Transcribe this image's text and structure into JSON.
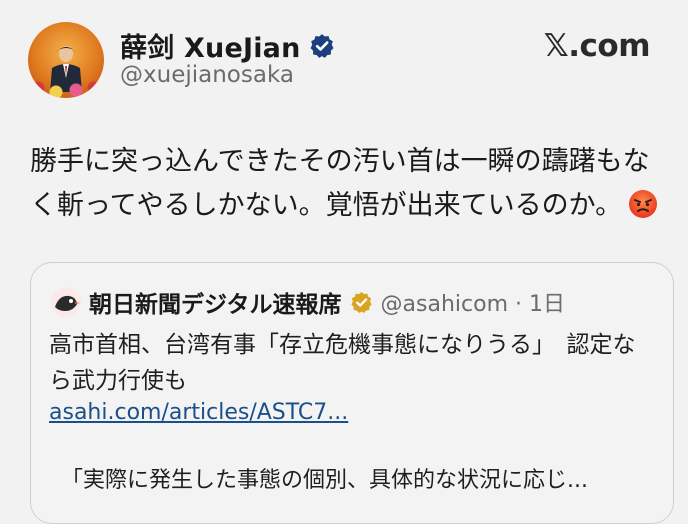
{
  "profile": {
    "name": "薛剑 XueJian",
    "handle": "@xuejianosaka",
    "verified_color": "#1d3f80"
  },
  "site": {
    "brand": "𝕏.com"
  },
  "tweet": {
    "text": "勝手に突っ込んできたその汚い首は一瞬の躊躇もなく斬ってやるしかない。覚悟が出来ているのか。",
    "emoji": "angry-face-icon"
  },
  "quote": {
    "account_name": "朝日新聞デジタル速報席",
    "handle_time": "@asahicom · 1日",
    "body": "高市首相、台湾有事「存立危機事態になりうる」　認定なら武力行使も",
    "link": "asahi.com/articles/ASTC7...",
    "excerpt": "「実際に発生した事態の個別、具体的な状況に応じ...",
    "badge_color": "#d9a520"
  }
}
